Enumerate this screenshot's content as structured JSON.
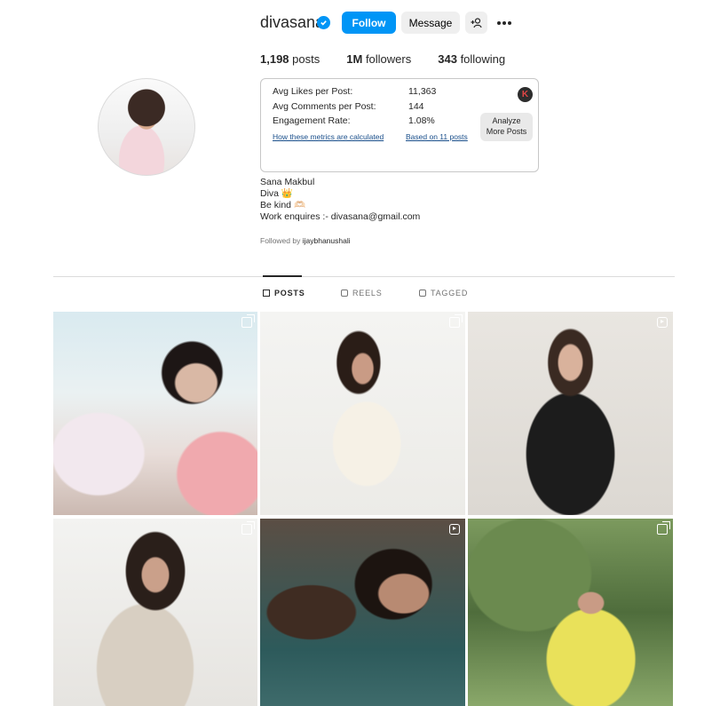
{
  "profile": {
    "username": "divasana",
    "follow_label": "Follow",
    "message_label": "Message",
    "stats": {
      "posts": "1,198",
      "posts_label": "posts",
      "followers": "1M",
      "followers_label": "followers",
      "following": "343",
      "following_label": "following"
    }
  },
  "metrics": {
    "rows": [
      {
        "label": "Avg Likes per Post:",
        "value": "11,363"
      },
      {
        "label": "Avg Comments per Post:",
        "value": "144"
      },
      {
        "label": "Engagement Rate:",
        "value": "1.08%"
      }
    ],
    "how_link": "How these metrics are calculated",
    "based_link": "Based on 11 posts",
    "logo_letter": "K",
    "analyze_line1": "Analyze",
    "analyze_line2": "More Posts"
  },
  "bio": {
    "name": "Sana Makbul",
    "line1": "Diva 👑",
    "line2": "Be kind 🫶🏻",
    "line3": "Work enquires :- divasana@gmail.com",
    "followed_prefix": "Followed by",
    "followed_user": "ijaybhanushali"
  },
  "tabs": {
    "posts": "POSTS",
    "reels": "REELS",
    "tagged": "TAGGED"
  },
  "colors": {
    "accent": "#0095f6",
    "text": "#262626",
    "muted": "#737373"
  }
}
